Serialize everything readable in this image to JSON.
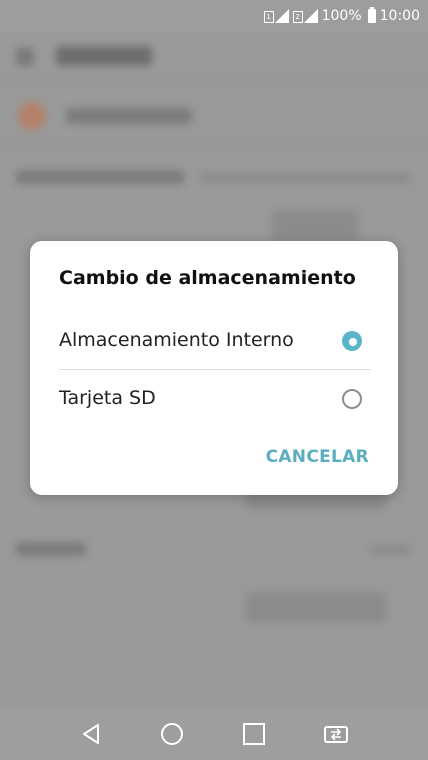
{
  "status_bar": {
    "battery_percent": "100%",
    "time": "10:00",
    "icons": [
      "sim-1-signal-icon",
      "sim-2-signal-icon",
      "battery-icon"
    ]
  },
  "dialog": {
    "title": "Cambio de almacenamiento",
    "options": [
      {
        "label": "Almacenamiento Interno",
        "selected": true
      },
      {
        "label": "Tarjeta SD",
        "selected": false
      }
    ],
    "cancel_label": "CANCELAR",
    "accent_color": "#5ab5c6"
  },
  "nav_bar": {
    "icons": [
      "back-icon",
      "home-icon",
      "recents-icon",
      "dual-window-icon"
    ]
  }
}
